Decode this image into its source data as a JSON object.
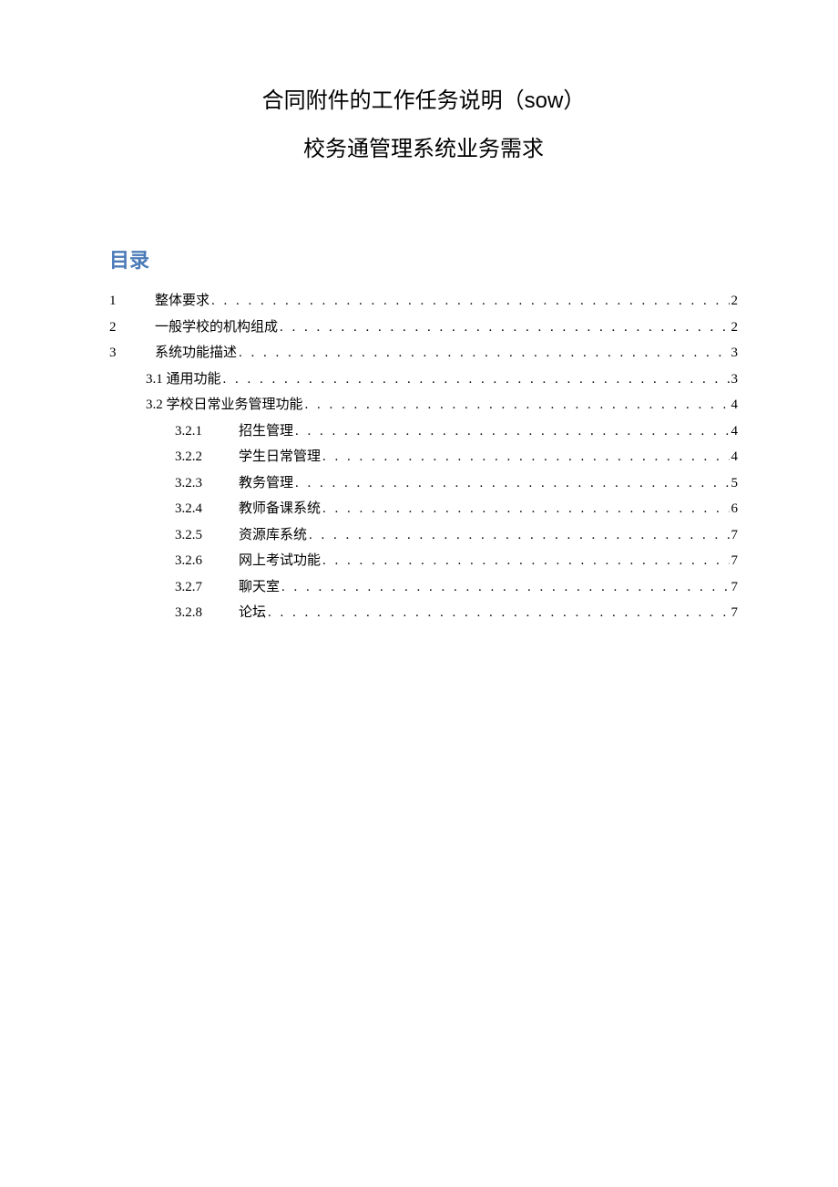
{
  "title": "合同附件的工作任务说明（sow）",
  "subtitle": "校务通管理系统业务需求",
  "toc_heading": "目录",
  "toc": [
    {
      "level": 1,
      "num": "1",
      "label": "整体要求",
      "page": "2"
    },
    {
      "level": 1,
      "num": "2",
      "label": "一般学校的机构组成",
      "page": "2"
    },
    {
      "level": 1,
      "num": "3",
      "label": "系统功能描述",
      "page": "3"
    },
    {
      "level": 2,
      "num": "",
      "label": "3.1 通用功能",
      "page": "3"
    },
    {
      "level": 2,
      "num": "",
      "label": "3.2 学校日常业务管理功能",
      "page": "4"
    },
    {
      "level": 3,
      "num": "3.2.1",
      "label": "招生管理",
      "page": "4"
    },
    {
      "level": 3,
      "num": "3.2.2",
      "label": "学生日常管理",
      "page": "4"
    },
    {
      "level": 3,
      "num": "3.2.3",
      "label": "教务管理",
      "page": "5"
    },
    {
      "level": 3,
      "num": "3.2.4",
      "label": "教师备课系统",
      "page": "6"
    },
    {
      "level": 3,
      "num": "3.2.5",
      "label": "资源库系统",
      "page": "7"
    },
    {
      "level": 3,
      "num": "3.2.6",
      "label": "网上考试功能",
      "page": "7"
    },
    {
      "level": 3,
      "num": "3.2.7",
      "label": "聊天室",
      "page": "7"
    },
    {
      "level": 3,
      "num": "3.2.8",
      "label": "论坛",
      "page": "7"
    }
  ]
}
